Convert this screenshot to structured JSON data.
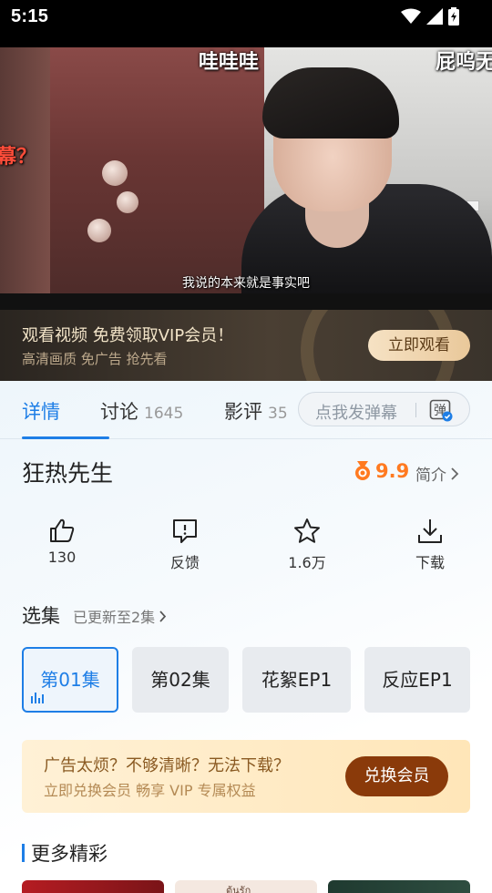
{
  "status_bar": {
    "time": "5:15"
  },
  "video": {
    "danmaku": [
      "哇哇哇",
      "屁呜无",
      "幕？"
    ],
    "subtitle": "我说的本来就是事实吧"
  },
  "vip_banner": {
    "title": "观看视频 免费领取VIP会员！",
    "subtitle": "高清画质 免广告 抢先看",
    "button": "立即观看"
  },
  "tabs": [
    {
      "label": "详情",
      "count": ""
    },
    {
      "label": "讨论",
      "count": "1645"
    },
    {
      "label": "影评",
      "count": "35"
    }
  ],
  "danmaku_input": {
    "placeholder": "点我发弹幕",
    "toggle_glyph": "弹"
  },
  "show": {
    "title": "狂热先生",
    "score": "9.9",
    "intro_label": "简介"
  },
  "actions": [
    {
      "label": "130",
      "icon": "thumbs-up-icon"
    },
    {
      "label": "反馈",
      "icon": "feedback-icon"
    },
    {
      "label": "1.6万",
      "icon": "star-icon"
    },
    {
      "label": "下载",
      "icon": "download-icon"
    }
  ],
  "episodes": {
    "title": "选集",
    "updated": "已更新至2集",
    "items": [
      "第01集",
      "第02集",
      "花絮EP1",
      "反应EP1"
    ]
  },
  "ad_card": {
    "title": "广告太烦？不够清晰？无法下载？",
    "subtitle": "立即兑换会员 畅享 VIP 专属权益",
    "button": "兑换会员"
  },
  "more": {
    "title": "更多精彩",
    "thumb_caption": "ต้นรัก"
  },
  "colors": {
    "accent": "#1e7ee6",
    "score": "#ff7a20",
    "vip_gold": "#e9c89a",
    "ad_button": "#8a3a0a"
  }
}
